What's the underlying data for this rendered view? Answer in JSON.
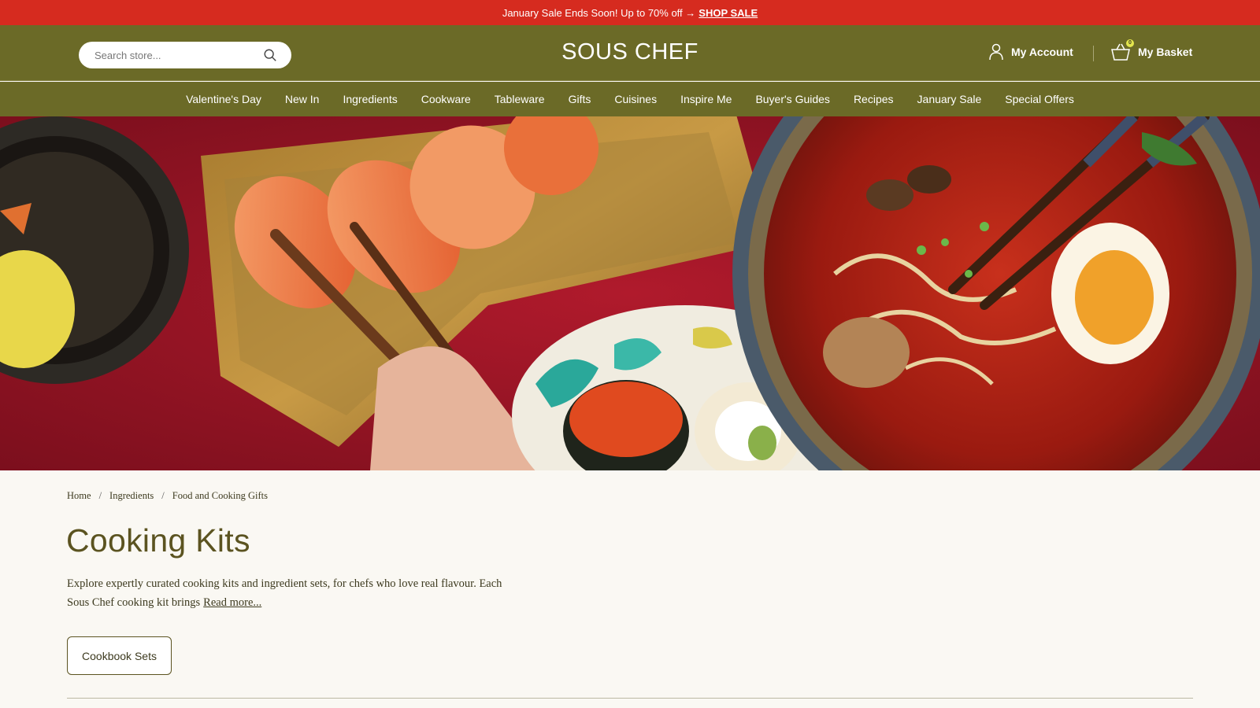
{
  "promo": {
    "text": "January Sale Ends Soon! Up to 70% off →",
    "link": "SHOP SALE"
  },
  "header": {
    "search_placeholder": "Search store...",
    "logo": "SOUS CHEF",
    "account_label": "My Account",
    "basket_label": "My Basket",
    "basket_count": "0"
  },
  "nav": [
    "Valentine's Day",
    "New In",
    "Ingredients",
    "Cookware",
    "Tableware",
    "Gifts",
    "Cuisines",
    "Inspire Me",
    "Buyer's Guides",
    "Recipes",
    "January Sale",
    "Special Offers"
  ],
  "breadcrumb": [
    "Home",
    "Ingredients",
    "Food and Cooking Gifts"
  ],
  "page": {
    "title": "Cooking Kits",
    "description": "Explore expertly curated cooking kits and ingredient sets, for chefs who love real flavour. Each Sous Chef cooking kit brings",
    "read_more": "Read more...",
    "chip": "Cookbook Sets"
  },
  "colors": {
    "promo_bg": "#d62b1f",
    "header_bg": "#6b6a27",
    "page_bg": "#faf8f3",
    "title": "#5b5320"
  }
}
